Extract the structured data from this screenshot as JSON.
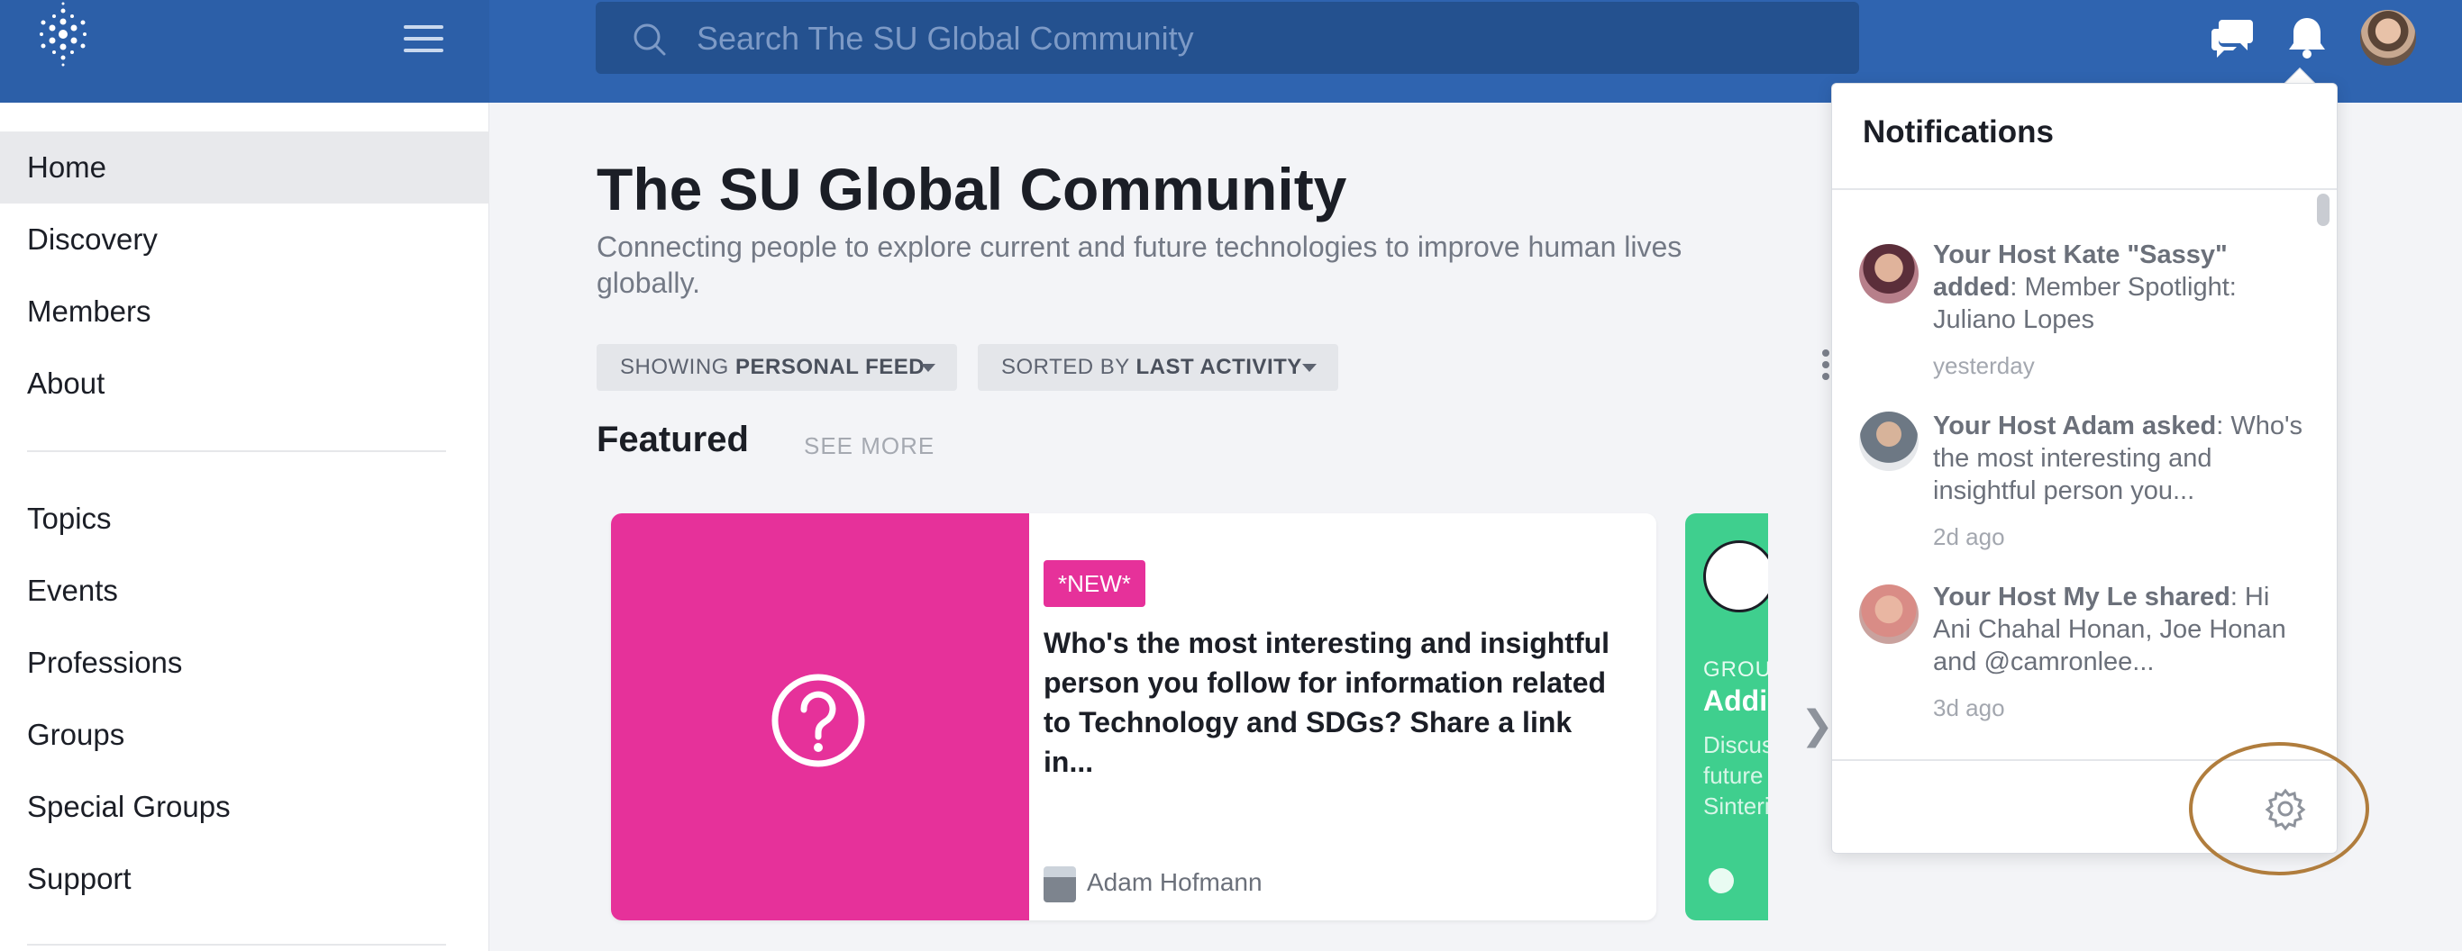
{
  "header": {
    "search_placeholder": "Search The SU Global Community",
    "logo_icon": "snowflake-network-icon",
    "menu_icon": "hamburger-icon",
    "messages_icon": "chat-bubbles-icon",
    "notifications_icon": "bell-icon",
    "colors": {
      "bar": "#2f64b0",
      "search": "#24518f"
    }
  },
  "sidebar": {
    "items": [
      {
        "label": "Home",
        "active": true
      },
      {
        "label": "Discovery"
      },
      {
        "label": "Members"
      },
      {
        "label": "About"
      }
    ],
    "items2": [
      {
        "label": "Topics"
      },
      {
        "label": "Events"
      },
      {
        "label": "Professions"
      },
      {
        "label": "Groups"
      },
      {
        "label": "Special Groups"
      },
      {
        "label": "Support"
      }
    ]
  },
  "main": {
    "title": "The SU Global Community",
    "subtitle": "Connecting people to explore current and future technologies to improve human lives globally.",
    "filters": [
      {
        "prefix": "SHOWING",
        "value": "PERSONAL FEED"
      },
      {
        "prefix": "SORTED BY",
        "value": "LAST ACTIVITY"
      }
    ],
    "featured_label": "Featured",
    "see_more": "SEE MORE",
    "card": {
      "badge": "*NEW*",
      "title": "Who's the most interesting and insightful person you follow for information related to Technology and SDGs? Share a link in...",
      "author": "Adam Hofmann",
      "media_icon": "question-circle-icon",
      "color": "#e6319a"
    },
    "card2": {
      "label": "GROU",
      "title": "Addi",
      "desc": [
        "Discus",
        "future",
        "Sinteri"
      ],
      "color": "#3fcf8e"
    }
  },
  "notifications": {
    "title": "Notifications",
    "items": [
      {
        "actor": "Your Host Kate \"Sassy\" added",
        "text": ": Member Spotlight: Juliano Lopes",
        "time": "yesterday"
      },
      {
        "actor": "Your Host Adam asked",
        "text": ": Who's the most interesting and insightful person you...",
        "time": "2d ago"
      },
      {
        "actor": "Your Host My Le shared",
        "text": ": Hi Ani Chahal Honan, Joe Honan and @camronlee...",
        "time": "3d ago"
      }
    ],
    "settings_icon": "gear-icon"
  }
}
